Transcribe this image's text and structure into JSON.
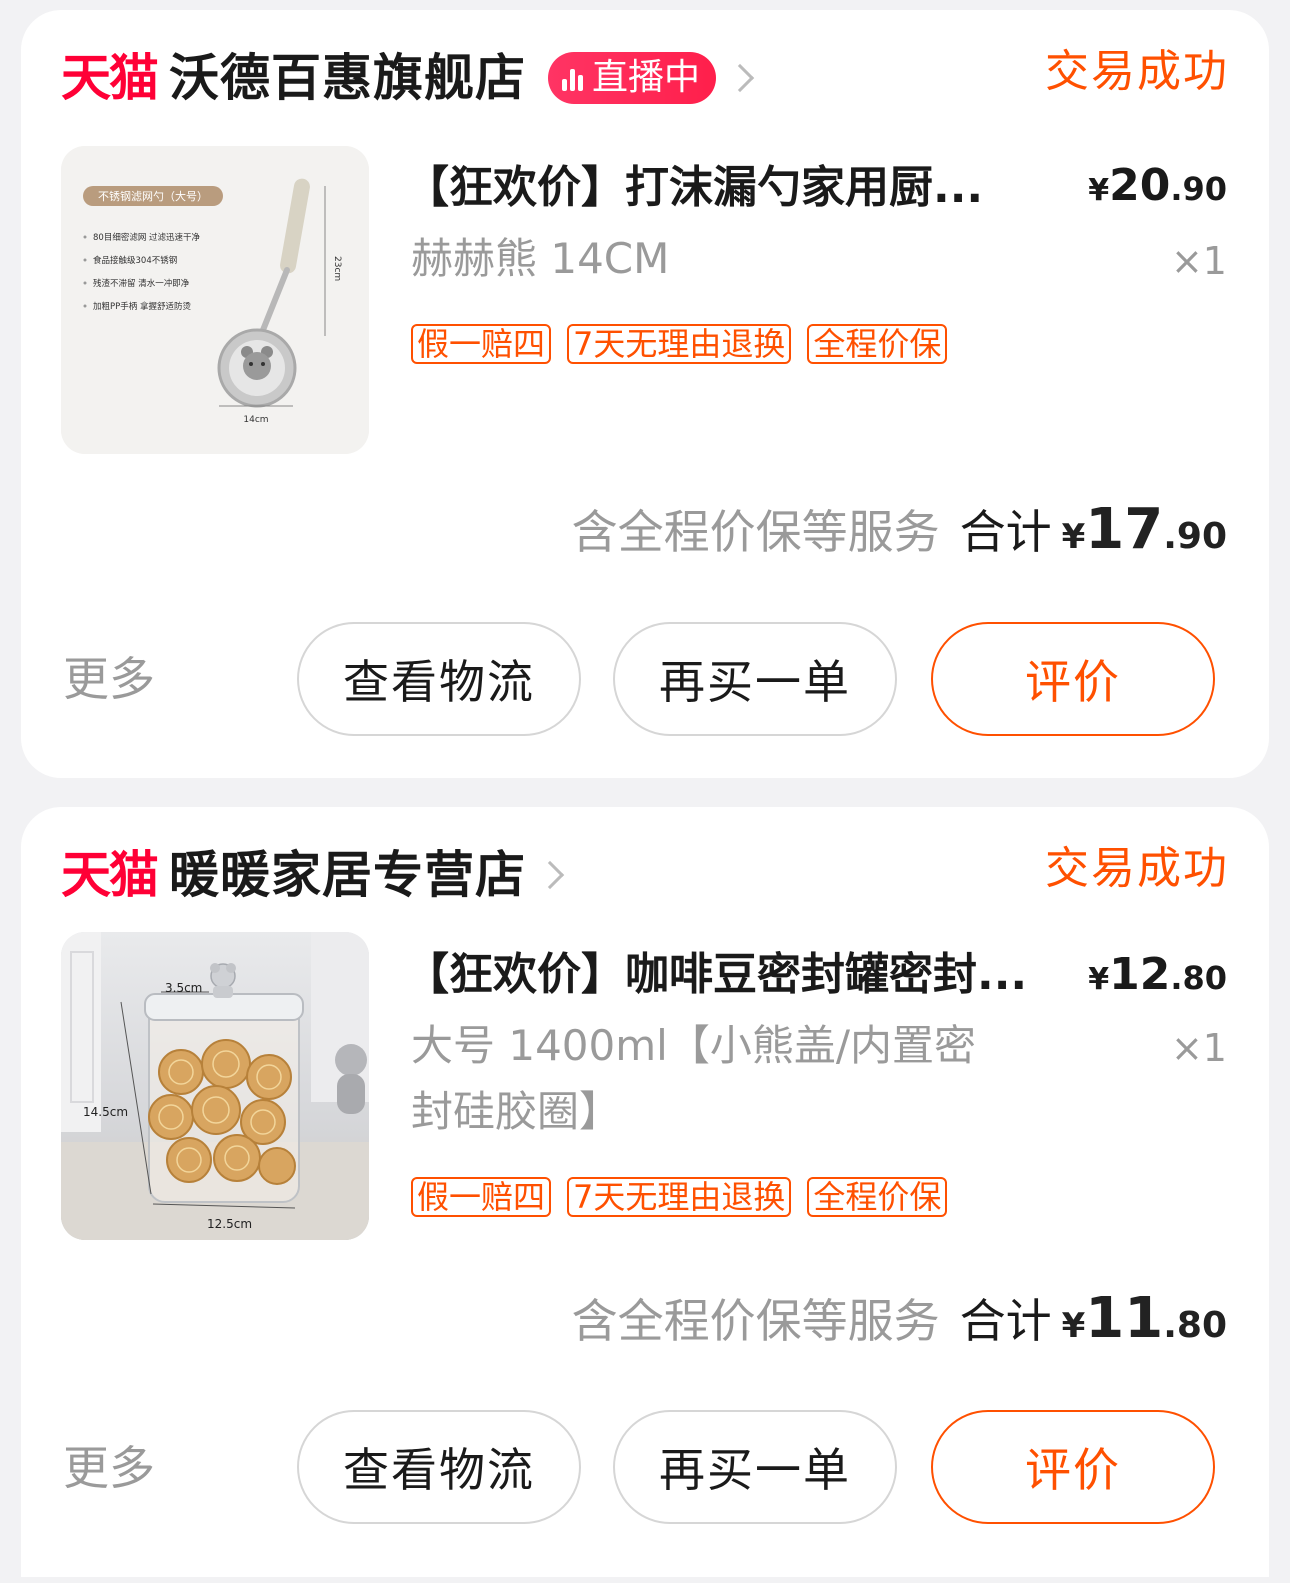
{
  "orders": [
    {
      "platform_logo": "天猫",
      "shop_name": "沃德百惠旗舰店",
      "live_badge": "直播中",
      "status": "交易成功",
      "product": {
        "title": "【狂欢价】打沫漏勺家用厨...",
        "spec": "赫赫熊 14CM",
        "price_yen": "¥",
        "price_int": "20",
        "price_dec": ".90",
        "qty": "×1",
        "image_icon": "skimmer-ladle-product-photo",
        "image_texts": {
          "badge": "不锈钢滤网勺（大号）",
          "bullets": [
            "80目细密滤网 过滤迅速干净",
            "食品接触级304不锈钢",
            "残渣不滞留 清水一冲即净",
            "加粗PP手柄 拿握舒适防烫"
          ],
          "length": "23cm",
          "width": "14cm"
        }
      },
      "tags": [
        "假一赔四",
        "7天无理由退换",
        "全程价保"
      ],
      "service_note": "含全程价保等服务",
      "total_label": "合计",
      "total_yen": "¥",
      "total_int": "17",
      "total_dec": ".90",
      "more_label": "更多",
      "buttons": {
        "logistics": "查看物流",
        "rebuy": "再买一单",
        "review": "评价"
      }
    },
    {
      "platform_logo": "天猫",
      "shop_name": "暖暖家居专营店",
      "status": "交易成功",
      "product": {
        "title": "【狂欢价】咖啡豆密封罐密封...",
        "spec_line1": "大号 1400ml【小熊盖/内置密",
        "spec_line2": "封硅胶圈】",
        "price_yen": "¥",
        "price_int": "12",
        "price_dec": ".80",
        "qty": "×1",
        "image_icon": "glass-jar-product-photo",
        "image_texts": {
          "top": "3.5cm",
          "height": "14.5cm",
          "width": "12.5cm"
        }
      },
      "tags": [
        "假一赔四",
        "7天无理由退换",
        "全程价保"
      ],
      "service_note": "含全程价保等服务",
      "total_label": "合计",
      "total_yen": "¥",
      "total_int": "11",
      "total_dec": ".80",
      "more_label": "更多",
      "buttons": {
        "logistics": "查看物流",
        "rebuy": "再买一单",
        "review": "评价"
      }
    }
  ],
  "colors": {
    "brand_red": "#ff0036",
    "accent_orange": "#ff5000",
    "muted_gray": "#9a9a9a",
    "live_pink": "#ff2a58"
  }
}
